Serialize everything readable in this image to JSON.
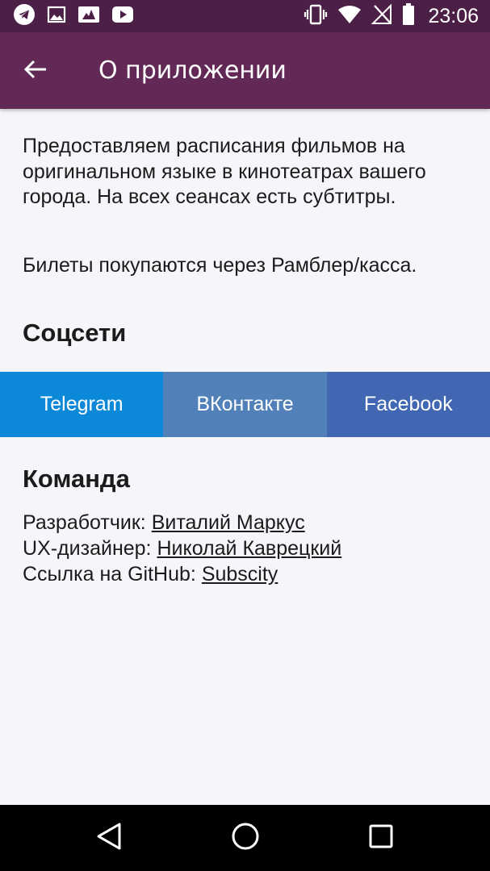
{
  "status_bar": {
    "time": "23:06",
    "left_icons": [
      "telegram-icon",
      "gallery-icon",
      "image-edit-icon",
      "youtube-icon"
    ],
    "right_icons": [
      "vibrate-icon",
      "wifi-icon",
      "no-signal-icon",
      "battery-icon"
    ]
  },
  "app_bar": {
    "back_icon": "arrow-left-icon",
    "title": "О приложении"
  },
  "about": {
    "paragraph1": "Предоставляем расписания фильмов на оригинальном языке в кинотеатрах вашего города. На всех сеансах есть субтитры.",
    "paragraph2": "Билеты покупаются через Рамблер/касса."
  },
  "social": {
    "heading": "Соцсети",
    "buttons": [
      {
        "label": "Telegram",
        "color": "#0b88d8"
      },
      {
        "label": "ВКонтакте",
        "color": "#5181b8"
      },
      {
        "label": "Facebook",
        "color": "#4167b2"
      }
    ]
  },
  "team": {
    "heading": "Команда",
    "lines": [
      {
        "label": "Разработчик: ",
        "link": "Виталий Маркус"
      },
      {
        "label": "UX-дизайнер: ",
        "link": "Николай Каврецкий"
      },
      {
        "label": "Ссылка на GitHub: ",
        "link": "Subscity"
      }
    ]
  },
  "nav_bar": {
    "buttons": [
      "back-triangle-icon",
      "home-circle-icon",
      "recents-square-icon"
    ]
  },
  "colors": {
    "status_bar": "#4c1f47",
    "app_bar": "#632956",
    "background": "#f6f5f9",
    "text": "#1b1b1b"
  }
}
